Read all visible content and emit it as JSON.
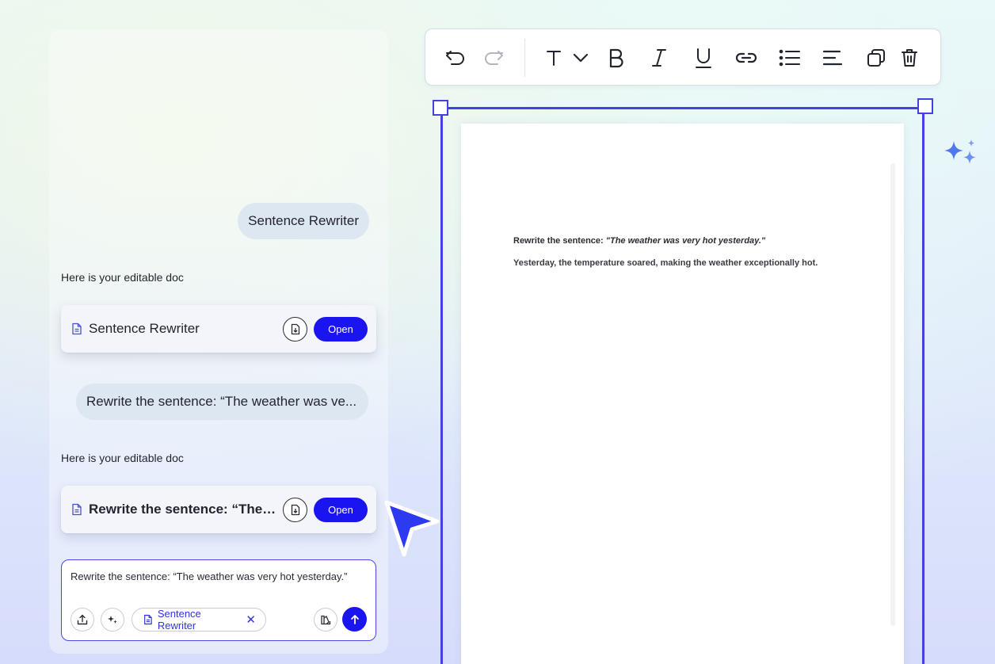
{
  "chat": {
    "messages": [
      {
        "role": "user",
        "text": "Sentence Rewriter"
      },
      {
        "role": "assistant",
        "text": "Here is your editable doc",
        "doc_title": "Sentence Rewriter",
        "open_label": "Open"
      },
      {
        "role": "user",
        "text": "Rewrite the sentence: “The weather was ve..."
      },
      {
        "role": "assistant",
        "text": "Here is your editable doc",
        "doc_title": "Rewrite the sentence: “The w...",
        "open_label": "Open"
      }
    ],
    "composer": {
      "value": "Rewrite the sentence: “The weather was very hot yesterday.”",
      "chip_label": "Sentence Rewriter",
      "chip_remove": "✕"
    }
  },
  "toolbar": {
    "buttons": [
      "undo-icon",
      "redo-icon",
      "text-style-icon",
      "chevron-down-icon",
      "bold-icon",
      "italic-icon",
      "underline-icon",
      "link-icon",
      "bullet-list-icon",
      "align-left-icon",
      "duplicate-icon",
      "delete-icon"
    ]
  },
  "document": {
    "line1_label": "Rewrite the sentence: ",
    "line1_quote": "\"The weather was very hot yesterday.\"",
    "line2": "Yesterday, the temperature soared, making the weather exceptionally hot."
  },
  "colors": {
    "accent": "#1a14f0",
    "selection": "#4540e0",
    "bubble": "#dde7f1"
  }
}
